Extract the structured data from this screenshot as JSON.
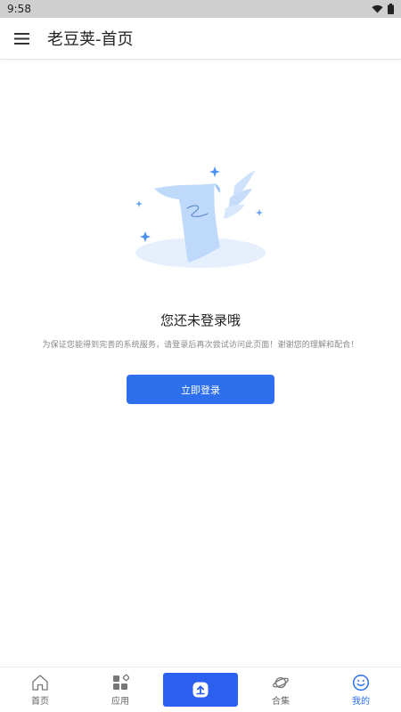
{
  "status_bar": {
    "time": "9:58"
  },
  "app_bar": {
    "title": "老豆荚-首页"
  },
  "empty_state": {
    "title": "您还未登录哦",
    "description": "为保证您能得到完善的系统服务，请登录后再次尝试访问此页面！谢谢您的理解和配合！",
    "button_label": "立即登录"
  },
  "bottom_nav": {
    "home": "首页",
    "apps": "应用",
    "collection": "合集",
    "mine": "我的"
  },
  "colors": {
    "accent": "#2d6fed",
    "upload_button": "#2a5ff0",
    "status_bar": "#cfcfcf"
  }
}
